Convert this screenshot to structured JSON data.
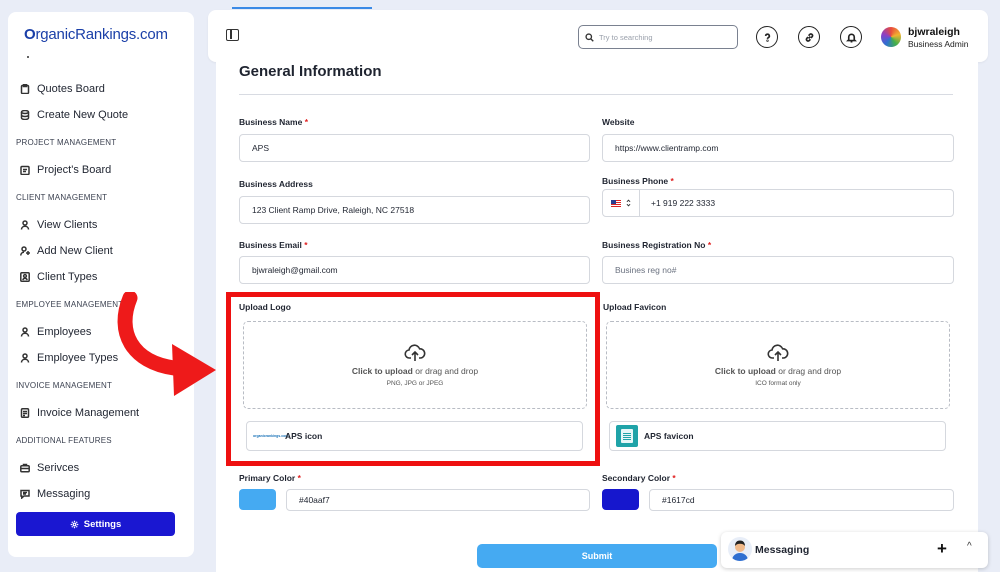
{
  "sidebar": {
    "brand": {
      "letter": "O",
      "rest": "rganicRankings.com"
    },
    "items": [
      {
        "label": "Quotes Board",
        "icon": "clipboard-icon"
      },
      {
        "label": "Create New Quote",
        "icon": "database-icon"
      },
      {
        "label": "Project's Board",
        "icon": "calendar-icon"
      },
      {
        "label": "View Clients",
        "icon": "user-icon"
      },
      {
        "label": "Add New Client",
        "icon": "user-plus-icon"
      },
      {
        "label": "Client Types",
        "icon": "user-square-icon"
      },
      {
        "label": "Employees",
        "icon": "user-icon"
      },
      {
        "label": "Employee Types",
        "icon": "user-icon"
      },
      {
        "label": "Invoice Management",
        "icon": "invoice-icon"
      },
      {
        "label": "Serivces",
        "icon": "briefcase-icon"
      },
      {
        "label": "Messaging",
        "icon": "message-icon"
      }
    ],
    "sections": {
      "project": "PROJECT MANAGEMENT",
      "client": "CLIENT MANAGEMENT",
      "employee": "EMPLOYEE MANAGEMENT",
      "invoice": "INVOICE MANAGEMENT",
      "additional": "ADDITIONAL FEATURES"
    },
    "settings_label": "Settings"
  },
  "header": {
    "search_placeholder": "Try to searching",
    "user_name": "bjwraleigh",
    "user_role": "Business Admin"
  },
  "form": {
    "title": "General Information",
    "business_name": {
      "label": "Business Name",
      "value": "APS"
    },
    "website": {
      "label": "Website",
      "value": "https://www.clientramp.com"
    },
    "business_address": {
      "label": "Business Address",
      "value": "123 Client Ramp Drive, Raleigh, NC 27518"
    },
    "business_phone": {
      "label": "Business Phone",
      "value": "+1 919 222 3333"
    },
    "business_email": {
      "label": "Business Email",
      "value": "bjwraleigh@gmail.com"
    },
    "registration_no": {
      "label": "Business Registration No",
      "placeholder": "Busines reg no#"
    },
    "upload_logo": {
      "label": "Upload Logo",
      "click": "Click to upload",
      "drag": "or drag and drop",
      "hint": "PNG, JPG or JPEG",
      "file_name": "APS icon",
      "thumb_text": "organicrankings.com"
    },
    "upload_favicon": {
      "label": "Upload Favicon",
      "click": "Click to upload",
      "drag": "or drag and drop",
      "hint": "ICO format only",
      "file_name": "APS favicon"
    },
    "primary_color": {
      "label": "Primary Color",
      "value": "#40aaf7"
    },
    "secondary_color": {
      "label": "Secondary Color",
      "value": "#1617cd"
    },
    "required_mark": "*",
    "submit_label": "Submit"
  },
  "messaging_widget": {
    "title": "Messaging",
    "plus": "+",
    "chevron": "^"
  },
  "colors": {
    "accent": "#1a17d1",
    "submit": "#45aaf2",
    "highlight": "#ee1010",
    "primary_swatch": "#45aaf2",
    "secondary_swatch": "#1617cd"
  }
}
